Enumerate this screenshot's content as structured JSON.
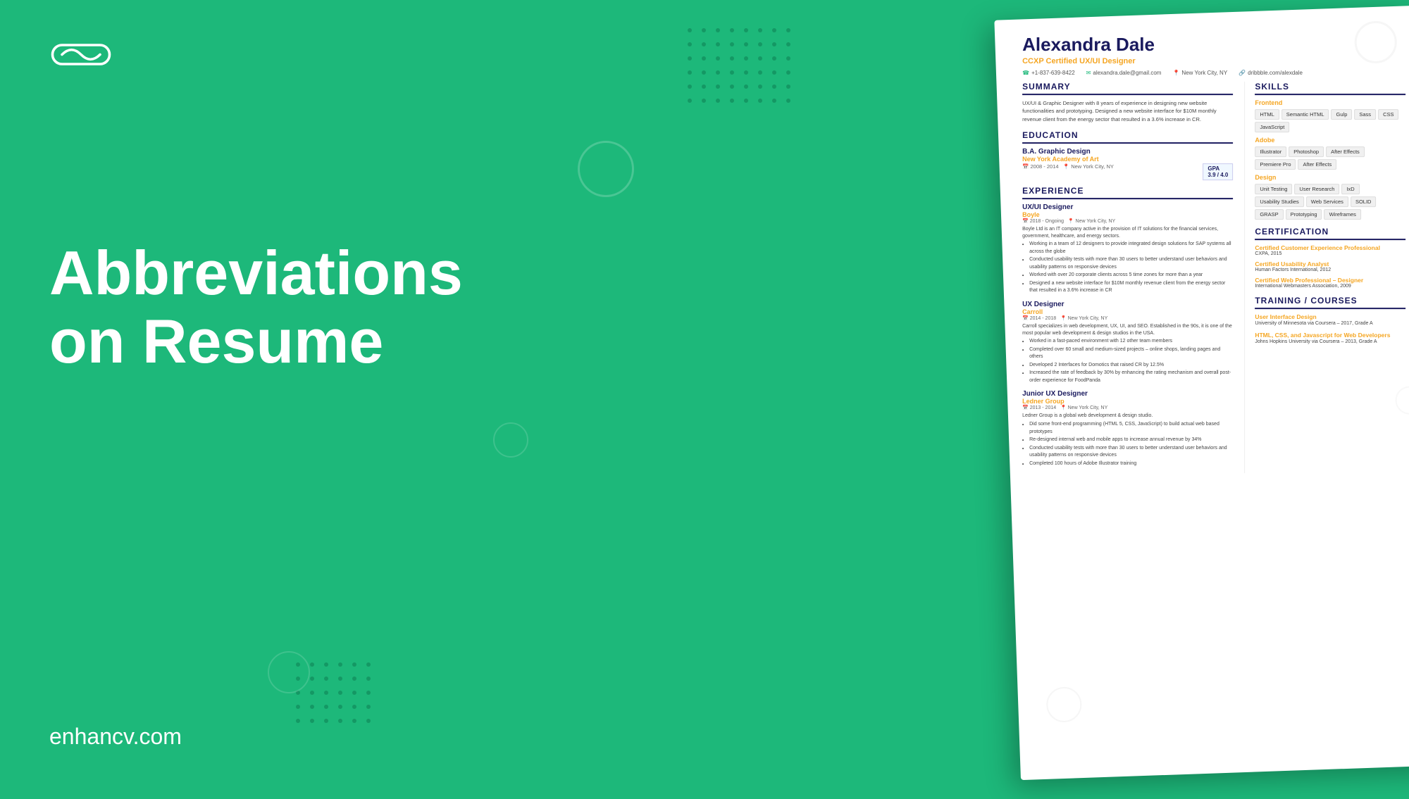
{
  "logo": {
    "alt": "EnhanceCV Logo",
    "icon": "∞"
  },
  "heading": {
    "line1": "Abbreviations",
    "line2": "on Resume"
  },
  "website": "enhancv.com",
  "resume": {
    "name": "Alexandra Dale",
    "title": "CCXP Certified UX/UI Designer",
    "phone": "+1-837-639-8422",
    "email": "alexandra.dale@gmail.com",
    "location": "New York City, NY",
    "portfolio": "dribbble.com/alexdale",
    "sections": {
      "summary": {
        "heading": "SUMMARY",
        "text": "UX/UI & Graphic Designer with 8 years of experience in designing new website functionalities and prototyping. Designed a new website interface for $10M monthly revenue client from the energy sector that resulted in a 3.6% increase in CR."
      },
      "education": {
        "heading": "EDUCATION",
        "entries": [
          {
            "degree": "B.A. Graphic Design",
            "school": "New York Academy of Art",
            "years": "2008 - 2014",
            "location": "New York City, NY",
            "gpa": "3.9 / 4.0"
          }
        ]
      },
      "experience": {
        "heading": "EXPERIENCE",
        "entries": [
          {
            "title": "UX/UI Designer",
            "company": "Boyle",
            "years": "2018 - Ongoing",
            "location": "New York City, NY",
            "description": "Boyle Ltd is an IT company active in the provision of IT solutions for the financial services, government, healthcare, and energy sectors.",
            "bullets": [
              "Working in a team of 12 designers to provide integrated design solutions for SAP systems all across the globe",
              "Conducted usability tests with more than 30 users to better understand user behaviors and usability patterns on responsive devices",
              "Worked with over 20 corporate clients across 5 time zones for more than a year",
              "Designed a new website interface for $10M monthly revenue client from the energy sector that resulted in a 3.6% increase in CR"
            ]
          },
          {
            "title": "UX Designer",
            "company": "Carroll",
            "years": "2014 - 2018",
            "location": "New York City, NY",
            "description": "Carroll specializes in web development, UX, UI, and SEO. Established in the 90s, it is one of the most popular web development & design studios in the USA.",
            "bullets": [
              "Worked in a fast-paced environment with 12 other team members",
              "Completed over 60 small and medium-sized projects – online shops, landing pages and others",
              "Developed 2 Interfaces for Domotics that raised CR by 12.5%",
              "Increased the rate of feedback by 30% by enhancing the rating mechanism and overall post-order experience for FoodPanda"
            ]
          },
          {
            "title": "Junior UX Designer",
            "company": "Ledner Group",
            "years": "2013 - 2014",
            "location": "New York City, NY",
            "description": "Ledner Group is a global web development & design studio.",
            "bullets": [
              "Did some front-end programming (HTML 5, CSS, JavaScript) to build actual web based prototypes",
              "Re-designed internal web and mobile apps to increase annual revenue by 34%",
              "Conducted usability tests with more than 30 users to better understand user behaviors and usability patterns on responsive devices",
              "Completed 100 hours of Adobe Illustrator training"
            ]
          }
        ]
      },
      "skills": {
        "heading": "SKILLS",
        "categories": [
          {
            "name": "Frontend",
            "tags": [
              "HTML",
              "Semantic HTML",
              "Gulp",
              "Sass",
              "CSS",
              "JavaScript"
            ]
          },
          {
            "name": "Adobe",
            "tags": [
              "Illustrator",
              "Photoshop",
              "After Effects",
              "Premiere Pro",
              "After Effects"
            ]
          },
          {
            "name": "Design",
            "tags": [
              "Unit Testing",
              "User Research",
              "IxD",
              "Usability Studies",
              "Web Services",
              "SOLID",
              "GRASP",
              "Prototyping",
              "Wireframes"
            ]
          }
        ]
      },
      "certification": {
        "heading": "CERTIFICATION",
        "entries": [
          {
            "name": "Certified Customer Experience Professional",
            "meta": "CXPA, 2015"
          },
          {
            "name": "Certified Usability Analyst",
            "meta": "Human Factors International, 2012"
          },
          {
            "name": "Certified Web Professional – Designer",
            "meta": "International Webmasters Association, 2009"
          }
        ]
      },
      "training": {
        "heading": "TRAINING / COURSES",
        "entries": [
          {
            "name": "User Interface Design",
            "meta": "University of Minnesota via Coursera – 2017, Grade A"
          },
          {
            "name": "HTML, CSS, and Javascript for Web Developers",
            "meta": "Johns Hopkins University via Coursera – 2013, Grade A"
          }
        ]
      }
    }
  }
}
